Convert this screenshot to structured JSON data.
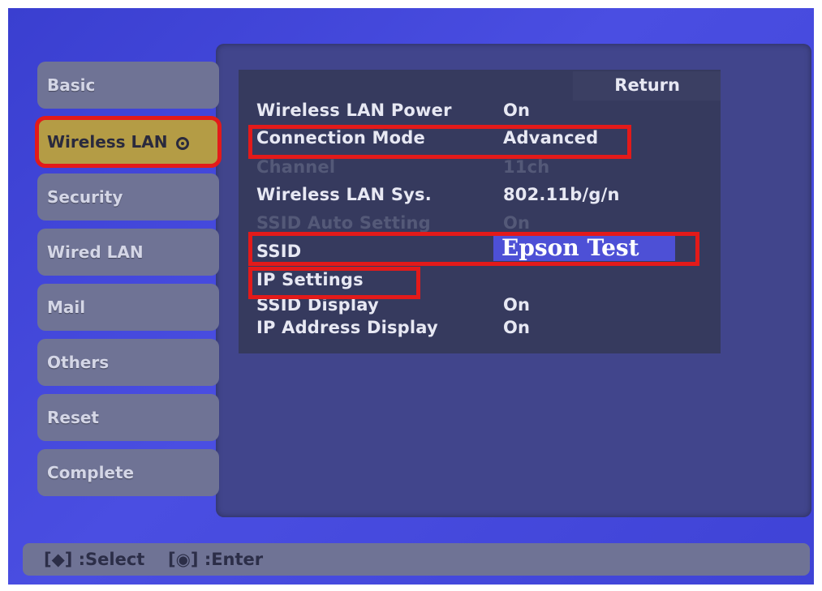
{
  "tabs": [
    {
      "label": "Basic"
    },
    {
      "label": "Wireless LAN"
    },
    {
      "label": "Security"
    },
    {
      "label": "Wired LAN"
    },
    {
      "label": "Mail"
    },
    {
      "label": "Others"
    },
    {
      "label": "Reset"
    },
    {
      "label": "Complete"
    }
  ],
  "return_label": "Return",
  "settings": [
    {
      "label": "Wireless LAN Power",
      "value": "On"
    },
    {
      "label": "Connection Mode",
      "value": "Advanced"
    },
    {
      "label": "Channel",
      "value": "11ch"
    },
    {
      "label": "Wireless LAN Sys.",
      "value": "802.11b/g/n"
    },
    {
      "label": "SSID Auto Setting",
      "value": "On"
    },
    {
      "label": "SSID",
      "value": "Epson  Test"
    },
    {
      "label": "IP Settings",
      "value": ""
    },
    {
      "label": "SSID Display",
      "value": "On"
    },
    {
      "label": "IP Address Display",
      "value": "On"
    }
  ],
  "status": {
    "select_hint": "[◆] :Select",
    "enter_hint": "[◉] :Enter"
  },
  "colors": {
    "background": "#4a4ee2",
    "highlight": "#e31a1a",
    "active_tab": "#b49c45"
  }
}
